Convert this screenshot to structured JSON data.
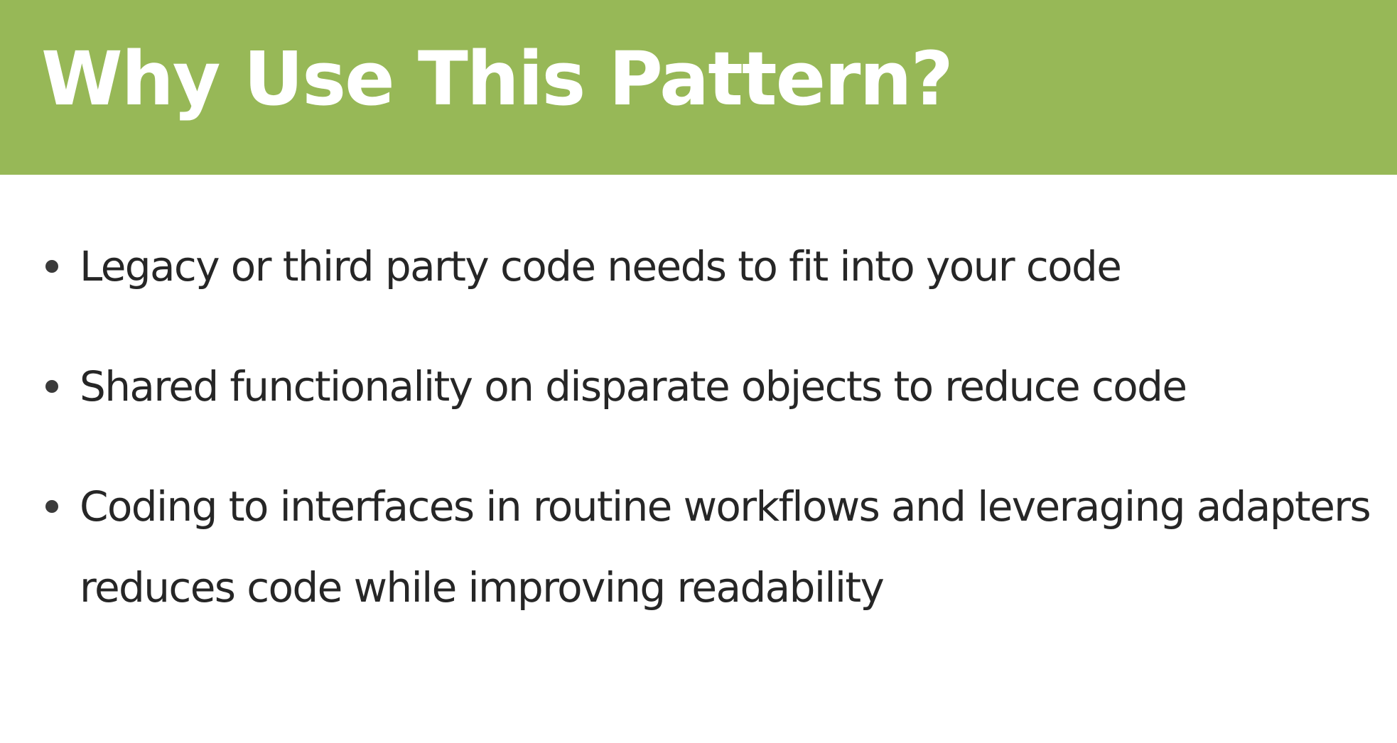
{
  "slide": {
    "title": "Why Use This Pattern?",
    "accent_color": "#97b857",
    "bullets": [
      "Legacy or third party code needs to fit into your code",
      "Shared functionality on disparate objects to reduce code",
      "Coding to interfaces in routine workflows and leveraging adapters reduces code while improving readability"
    ]
  }
}
